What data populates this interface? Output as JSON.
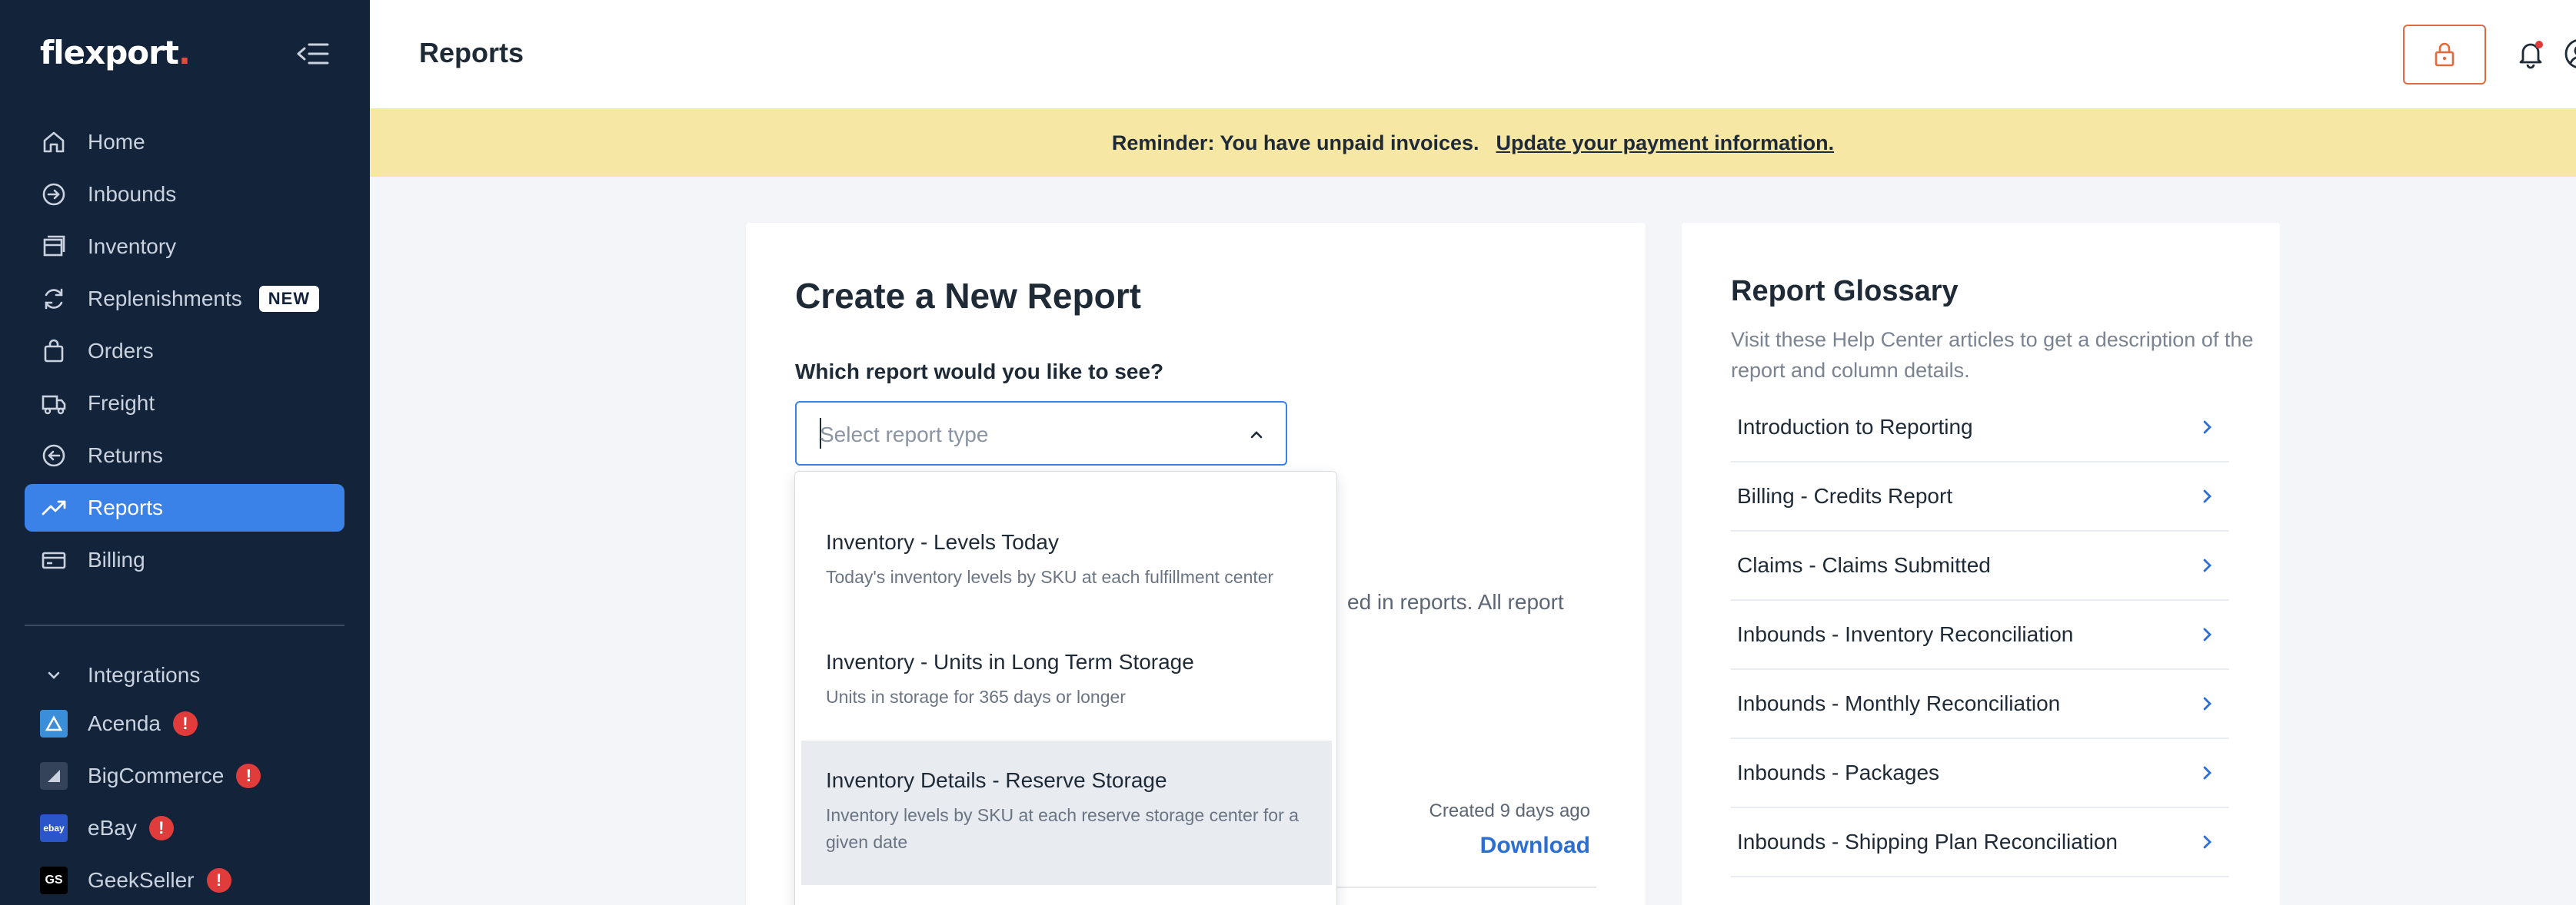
{
  "app": {
    "logo": "flexport",
    "logo_dot": "."
  },
  "sidebar": {
    "items": [
      {
        "label": "Home",
        "icon": "home-icon"
      },
      {
        "label": "Inbounds",
        "icon": "inbound-icon"
      },
      {
        "label": "Inventory",
        "icon": "inventory-icon"
      },
      {
        "label": "Replenishments",
        "icon": "refresh-icon",
        "badge": "NEW"
      },
      {
        "label": "Orders",
        "icon": "bag-icon"
      },
      {
        "label": "Freight",
        "icon": "truck-icon"
      },
      {
        "label": "Returns",
        "icon": "return-icon"
      },
      {
        "label": "Reports",
        "icon": "trend-icon",
        "active": true
      },
      {
        "label": "Billing",
        "icon": "billing-icon"
      }
    ],
    "integrations_label": "Integrations",
    "integrations": [
      {
        "label": "Acenda",
        "alert": "!"
      },
      {
        "label": "BigCommerce",
        "alert": "!"
      },
      {
        "label": "eBay",
        "alert": "!",
        "logo_text": "ebay"
      },
      {
        "label": "GeekSeller",
        "alert": "!",
        "logo_text": "GS"
      }
    ]
  },
  "header": {
    "title": "Reports"
  },
  "banner": {
    "text": "Reminder: You have unpaid invoices.",
    "link": "Update your payment information."
  },
  "create_report": {
    "title": "Create a New Report",
    "question": "Which report would you like to see?",
    "select_placeholder": "Select report type",
    "note_partial": "ed in reports. All report",
    "created": "Created 9 days ago",
    "download": "Download"
  },
  "dropdown": {
    "options": [
      {
        "title": "Inventory - Levels Today",
        "desc": "Today's inventory levels by SKU at each fulfillment center"
      },
      {
        "title": "Inventory - Units in Long Term Storage",
        "desc": "Units in storage for 365 days or longer"
      },
      {
        "title": "Inventory Details - Reserve Storage",
        "desc": "Inventory levels by SKU at each reserve storage center for a given date"
      }
    ]
  },
  "glossary": {
    "title": "Report Glossary",
    "desc": "Visit these Help Center articles to get a description of the report and column details.",
    "items": [
      "Introduction to Reporting",
      "Billing - Credits Report",
      "Claims - Claims Submitted",
      "Inbounds - Inventory Reconciliation",
      "Inbounds - Monthly Reconciliation",
      "Inbounds - Packages",
      "Inbounds - Shipping Plan Reconciliation"
    ]
  },
  "colors": {
    "sidebar_bg": "#13233a",
    "accent": "#3b82e8",
    "banner_bg": "#f6e7a4",
    "alert": "#e03c3c",
    "lock_border": "#e26a3d"
  }
}
